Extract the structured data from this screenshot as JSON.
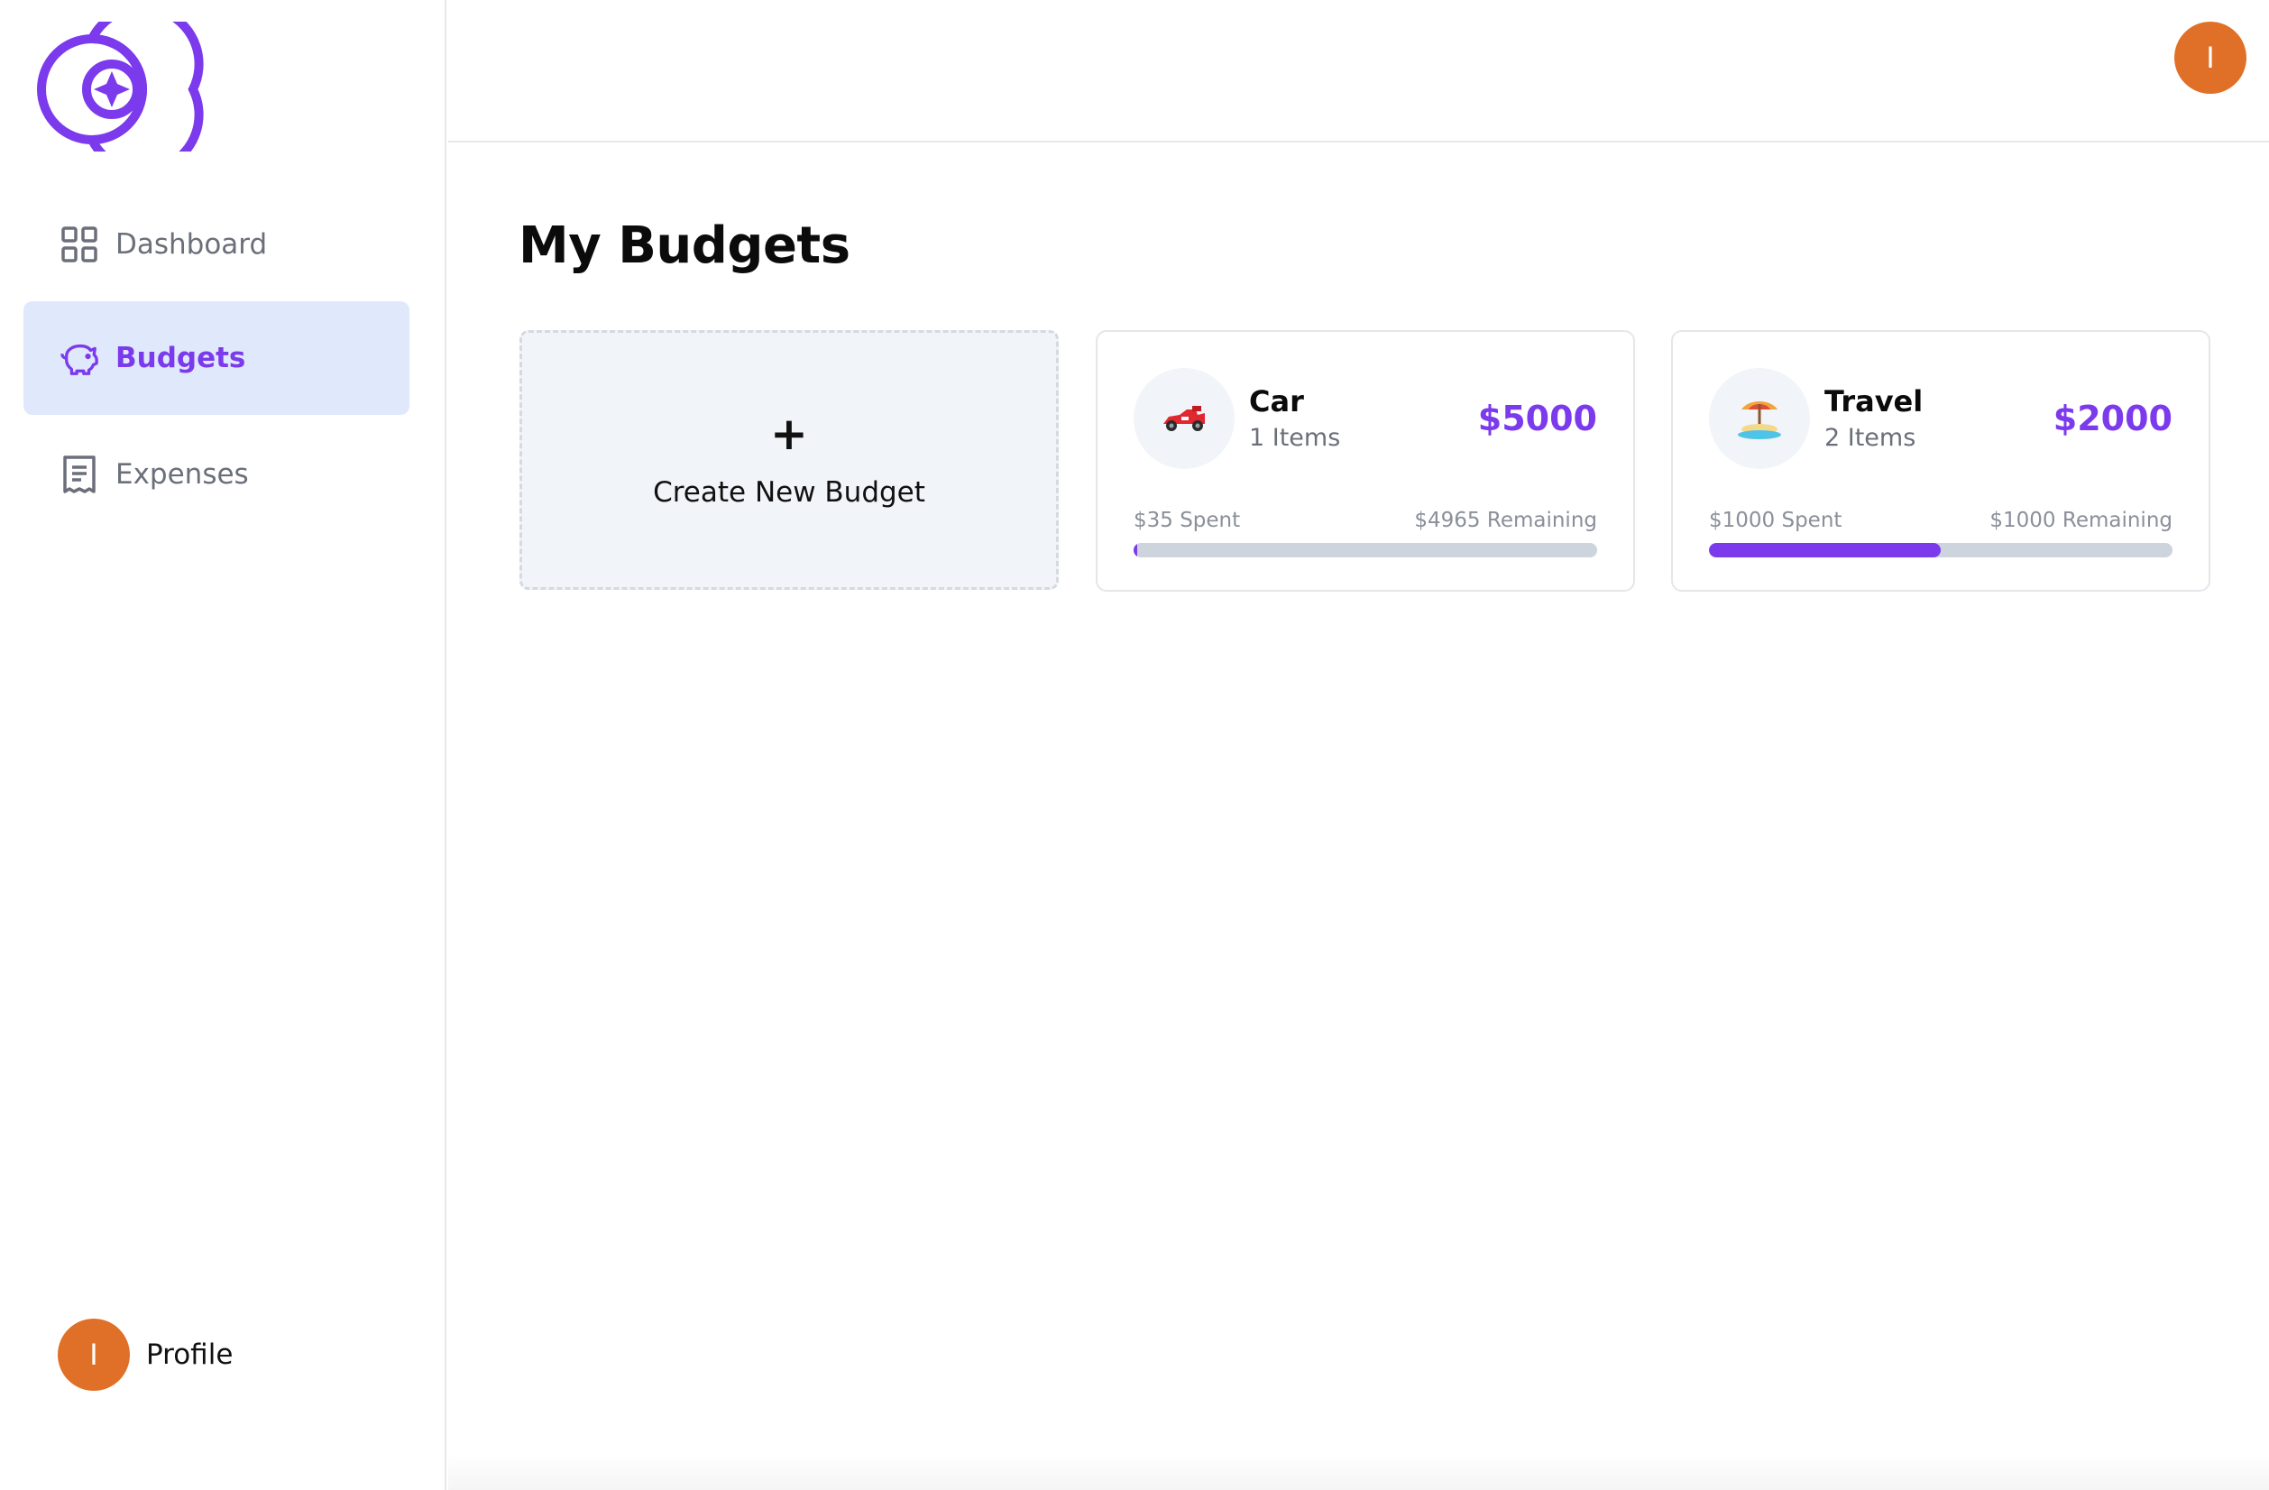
{
  "app": {
    "logo_icon": "budget-app-logo-icon",
    "accent_color": "#7c3aed",
    "avatar_color": "#e07027"
  },
  "sidebar": {
    "items": [
      {
        "label": "Dashboard",
        "icon": "grid-icon",
        "active": false
      },
      {
        "label": "Budgets",
        "icon": "piggy-bank-icon",
        "active": true
      },
      {
        "label": "Expenses",
        "icon": "receipt-icon",
        "active": false
      }
    ],
    "profile": {
      "initial": "I",
      "label": "Profile"
    }
  },
  "header": {
    "avatar_initial": "I"
  },
  "main": {
    "title": "My Budgets",
    "create_card": {
      "plus": "+",
      "label": "Create New Budget"
    },
    "budgets": [
      {
        "emoji": "🏎️",
        "name": "Car",
        "items": "1 Items",
        "amount": "$5000",
        "spent": "$35 Spent",
        "remaining": "$4965 Remaining",
        "progress": 0.007
      },
      {
        "emoji": "🏝️",
        "name": "Travel",
        "items": "2 Items",
        "amount": "$2000",
        "spent": "$1000 Spent",
        "remaining": "$1000 Remaining",
        "progress": 0.5
      }
    ]
  }
}
